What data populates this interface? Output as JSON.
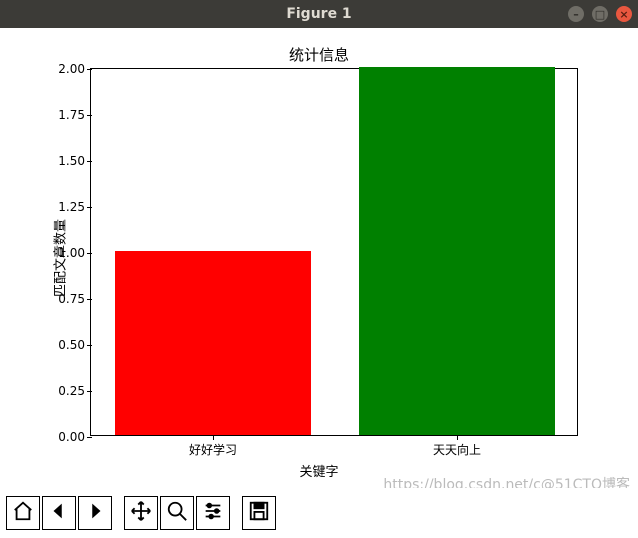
{
  "window": {
    "title": "Figure 1"
  },
  "chart_data": {
    "type": "bar",
    "title": "统计信息",
    "xlabel": "关键字",
    "ylabel": "匹配文章数量",
    "categories": [
      "好好学习",
      "天天向上"
    ],
    "values": [
      1.0,
      2.0
    ],
    "colors": [
      "#ff0000",
      "#008000"
    ],
    "ylim": [
      0.0,
      2.0
    ],
    "yticks": [
      0.0,
      0.25,
      0.5,
      0.75,
      1.0,
      1.25,
      1.5,
      1.75,
      2.0
    ],
    "ytick_labels": [
      "0.00",
      "0.25",
      "0.50",
      "0.75",
      "1.00",
      "1.25",
      "1.50",
      "1.75",
      "2.00"
    ]
  },
  "toolbar": {
    "home": "Home",
    "back": "Back",
    "forward": "Forward",
    "pan": "Pan",
    "zoom": "Zoom",
    "configure": "Configure subplots",
    "save": "Save"
  },
  "watermark": "https://blog.csdn.net/c@51CTO博客"
}
